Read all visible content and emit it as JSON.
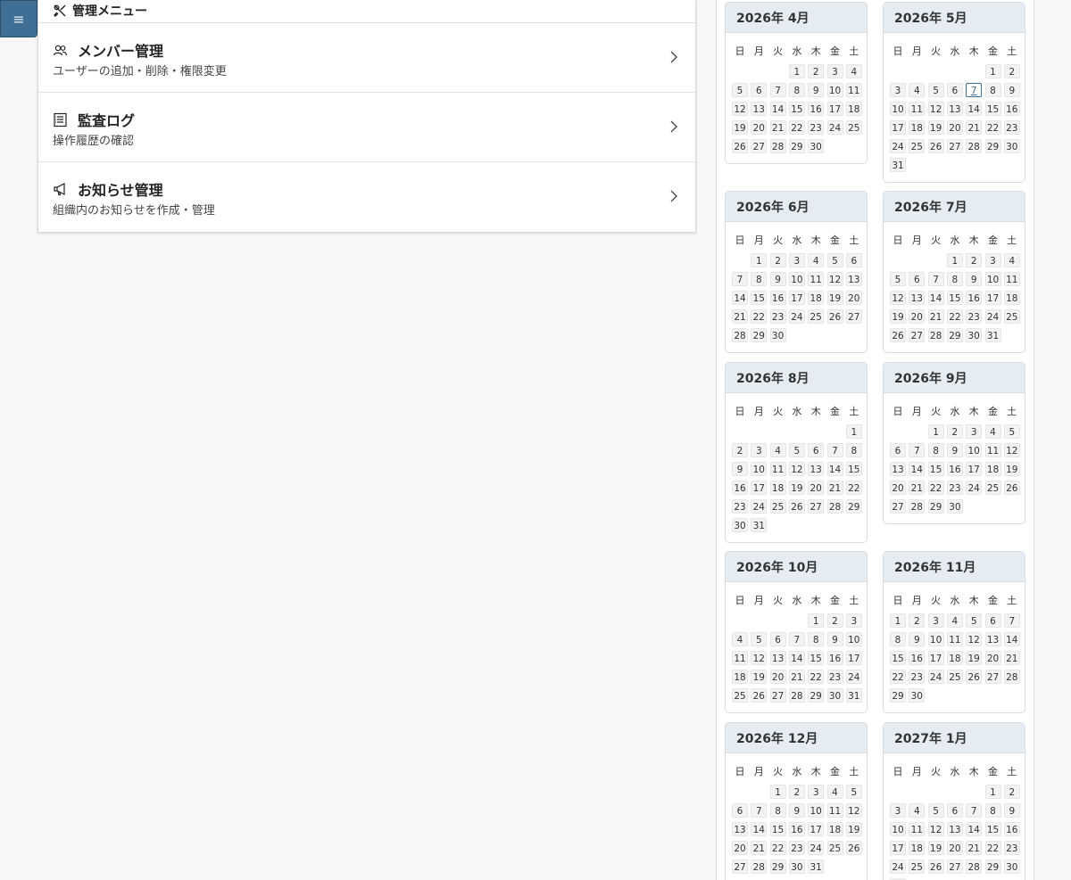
{
  "menu_toggle": {
    "icon": "hamburger-icon",
    "label": "≡"
  },
  "admin_menu": {
    "header": "管理メニュー",
    "header_icon": "tools-icon",
    "items": [
      {
        "icon": "users-icon",
        "title": "メンバー管理",
        "description": "ユーザーの追加・削除・権限変更"
      },
      {
        "icon": "log-icon",
        "title": "監査ログ",
        "description": "操作履歴の確認"
      },
      {
        "icon": "megaphone-icon",
        "title": "お知らせ管理",
        "description": "組織内のお知らせを作成・管理"
      }
    ]
  },
  "calendar": {
    "weekdays": [
      "日",
      "月",
      "火",
      "水",
      "木",
      "金",
      "土"
    ],
    "today": {
      "year": 2026,
      "month": 5,
      "day": 7
    },
    "accent_color": "#3f6f94",
    "months": [
      {
        "title": "2026年 4月",
        "year": 2026,
        "month": 4
      },
      {
        "title": "2026年 5月",
        "year": 2026,
        "month": 5
      },
      {
        "title": "2026年 6月",
        "year": 2026,
        "month": 6
      },
      {
        "title": "2026年 7月",
        "year": 2026,
        "month": 7
      },
      {
        "title": "2026年 8月",
        "year": 2026,
        "month": 8
      },
      {
        "title": "2026年 9月",
        "year": 2026,
        "month": 9
      },
      {
        "title": "2026年 10月",
        "year": 2026,
        "month": 10
      },
      {
        "title": "2026年 11月",
        "year": 2026,
        "month": 11
      },
      {
        "title": "2026年 12月",
        "year": 2026,
        "month": 12
      },
      {
        "title": "2027年 1月",
        "year": 2027,
        "month": 1
      }
    ]
  }
}
